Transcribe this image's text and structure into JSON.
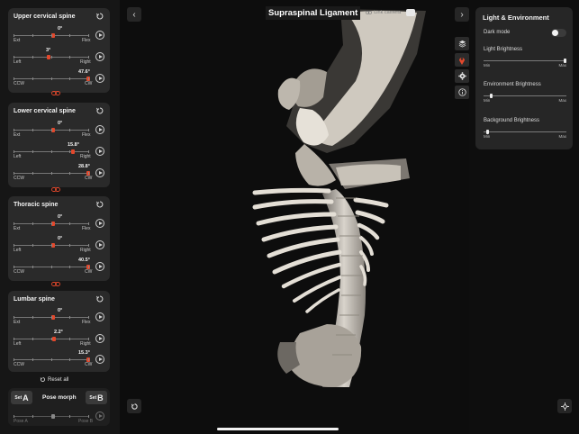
{
  "left_panel": {
    "sections": [
      {
        "title": "Upper cervical spine",
        "sliders": [
          {
            "value": "0°",
            "left": "Ext",
            "right": "Flex",
            "level": 0.52
          },
          {
            "value": "3°",
            "left": "Left",
            "right": "Right",
            "level": 0.46
          },
          {
            "value": "47.6°",
            "left": "CCW",
            "right": "CW",
            "level": 0.99
          }
        ]
      },
      {
        "title": "Lower cervical spine",
        "sliders": [
          {
            "value": "0°",
            "left": "Ext",
            "right": "Flex",
            "level": 0.52
          },
          {
            "value": "15.8°",
            "left": "Left",
            "right": "Right",
            "level": 0.78
          },
          {
            "value": "28.8°",
            "left": "CCW",
            "right": "CW",
            "level": 0.99
          }
        ]
      },
      {
        "title": "Thoracic spine",
        "sliders": [
          {
            "value": "0°",
            "left": "Ext",
            "right": "Flex",
            "level": 0.52
          },
          {
            "value": "0°",
            "left": "Left",
            "right": "Right",
            "level": 0.52
          },
          {
            "value": "40.5°",
            "left": "CCW",
            "right": "CW",
            "level": 0.99
          }
        ]
      },
      {
        "title": "Lumbar spine",
        "sliders": [
          {
            "value": "0°",
            "left": "Ext",
            "right": "Flex",
            "level": 0.52
          },
          {
            "value": "2.2°",
            "left": "Left",
            "right": "Right",
            "level": 0.53
          },
          {
            "value": "15.3°",
            "left": "CCW",
            "right": "CW",
            "level": 0.99
          }
        ]
      }
    ],
    "reset_all_label": "Reset all",
    "pose_morph": {
      "set_prefix": "Set",
      "a_letter": "A",
      "b_letter": "B",
      "title": "Pose morph",
      "min_label": "Pose A",
      "max_label": "Pose B",
      "level": 0.5
    }
  },
  "viewport": {
    "structure_title": "Supraspinal Ligament",
    "link_camera_label": "Link camera",
    "collapse_left_icon": "chevron-left-icon",
    "collapse_right_icon": "chevron-right-icon",
    "undo_icon": "undo-icon",
    "recenter_icon": "crosshair-icon"
  },
  "toolbar": {
    "items": [
      "layers-icon",
      "pin-icon",
      "gear-icon",
      "info-icon"
    ],
    "active_color": "#e2482c"
  },
  "right_panel": {
    "title": "Light & Environment",
    "dark_mode_label": "Dark mode",
    "dark_mode_on": false,
    "sliders": [
      {
        "label": "Light Brightness",
        "min": "Min",
        "max": "Max",
        "level": 1.0
      },
      {
        "label": "Environment Brightness",
        "min": "Min",
        "max": "Max",
        "level": 0.08
      },
      {
        "label": "Background Brightness",
        "min": "Min",
        "max": "Max",
        "level": 0.04
      }
    ]
  },
  "colors": {
    "accent": "#e2482c",
    "panel_bg": "#161616",
    "card_bg": "#2a2a2a",
    "viewport_bg": "#0d0d0d"
  }
}
